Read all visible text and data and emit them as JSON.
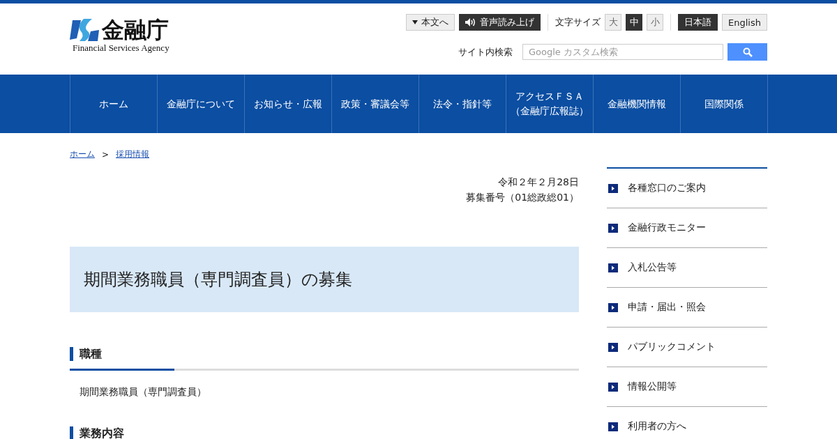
{
  "logo": {
    "name": "金融庁",
    "subtitle": "Financial Services Agency"
  },
  "utility": {
    "skip_link": "本文へ",
    "read_aloud": "音声読み上げ",
    "text_size_label": "文字サイズ",
    "text_sizes": [
      {
        "label": "大",
        "selected": false
      },
      {
        "label": "中",
        "selected": true
      },
      {
        "label": "小",
        "selected": false
      }
    ],
    "languages": [
      {
        "label": "日本語",
        "selected": true
      },
      {
        "label": "English",
        "selected": false
      }
    ]
  },
  "search": {
    "label": "サイト内検索",
    "placeholder": "Google カスタム検索"
  },
  "nav": [
    {
      "label": "ホーム"
    },
    {
      "label": "金融庁について"
    },
    {
      "label": "お知らせ・広報"
    },
    {
      "label": "政策・審議会等"
    },
    {
      "label": "法令・指針等"
    },
    {
      "label": "アクセスＦＳＡ（金融庁広報誌）"
    },
    {
      "label": "金融機関情報"
    },
    {
      "label": "国際関係"
    }
  ],
  "breadcrumb": [
    "ホーム",
    "採用情報"
  ],
  "breadcrumb_separator": ">",
  "date": "令和２年２月28日",
  "recruit_number": "募集番号（01総政総01）",
  "title": "期間業務職員（専門調査員）の募集",
  "sections": [
    {
      "heading": "職種",
      "body": "期間業務職員（専門調査員）"
    },
    {
      "heading": "業務内容"
    }
  ],
  "sidebar": [
    "各種窓口のご案内",
    "金融行政モニター",
    "入札公告等",
    "申請・届出・照会",
    "パブリックコメント",
    "情報公開等",
    "利用者の方へ"
  ]
}
